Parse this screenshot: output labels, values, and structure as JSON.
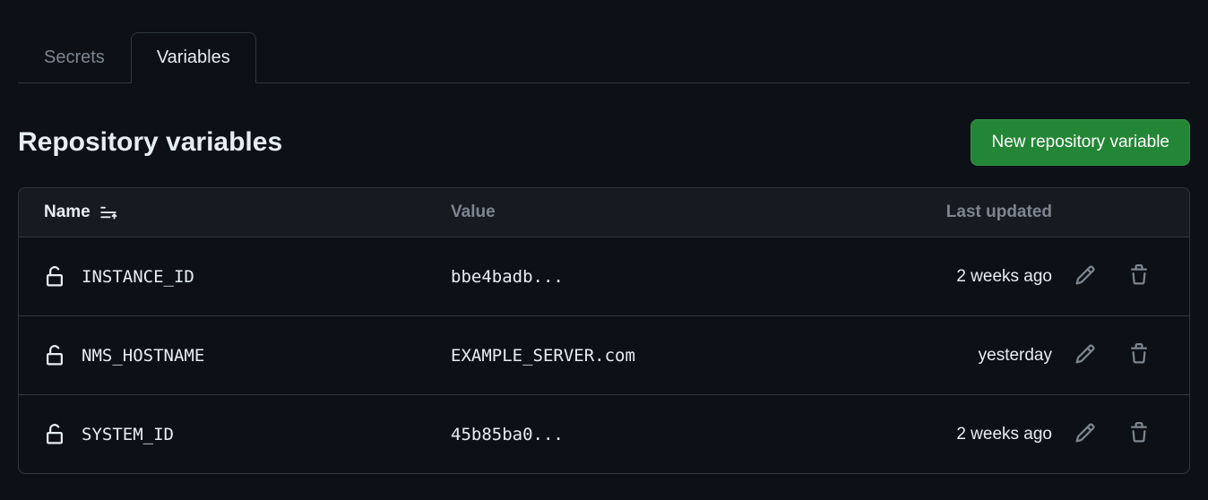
{
  "tabs": {
    "secrets": "Secrets",
    "variables": "Variables"
  },
  "header": {
    "title": "Repository variables",
    "new_button": "New repository variable"
  },
  "table": {
    "columns": {
      "name": "Name",
      "value": "Value",
      "updated": "Last updated"
    },
    "rows": [
      {
        "name": "INSTANCE_ID",
        "value": "bbe4badb...",
        "updated": "2 weeks ago"
      },
      {
        "name": "NMS_HOSTNAME",
        "value": "EXAMPLE_SERVER.com",
        "updated": "yesterday"
      },
      {
        "name": "SYSTEM_ID",
        "value": "45b85ba0...",
        "updated": "2 weeks ago"
      }
    ]
  }
}
